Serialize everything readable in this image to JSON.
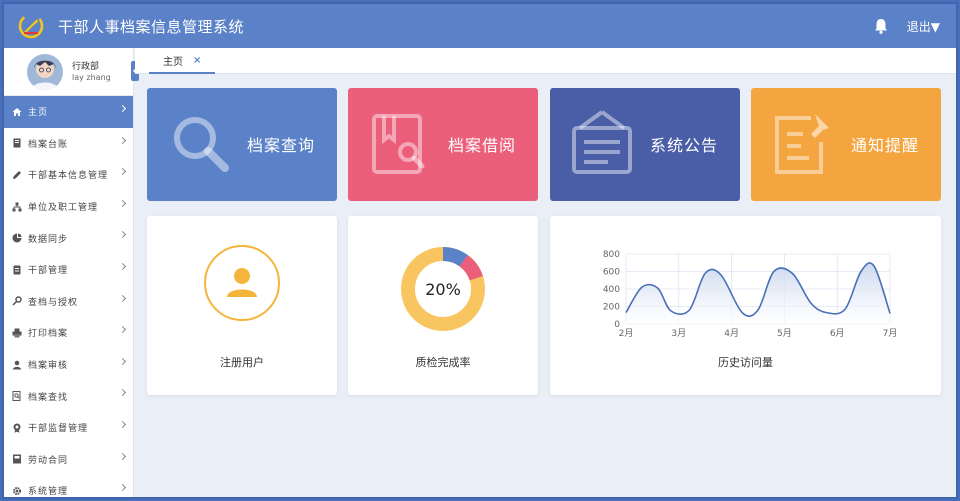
{
  "header": {
    "title": "干部人事档案信息管理系统",
    "logout_label": "退出▼"
  },
  "user": {
    "department": "行政部",
    "name": "lay zhang"
  },
  "sidebar": {
    "items": [
      {
        "label": "主页",
        "icon": "home-icon",
        "active": true
      },
      {
        "label": "档案台账",
        "icon": "book-icon"
      },
      {
        "label": "干部基本信息管理",
        "icon": "edit-icon"
      },
      {
        "label": "单位及职工管理",
        "icon": "org-icon"
      },
      {
        "label": "数据同步",
        "icon": "pie-icon"
      },
      {
        "label": "干部管理",
        "icon": "file-icon"
      },
      {
        "label": "查档与授权",
        "icon": "key-icon"
      },
      {
        "label": "打印档案",
        "icon": "print-icon"
      },
      {
        "label": "档案审核",
        "icon": "user-icon"
      },
      {
        "label": "档案查找",
        "icon": "search-doc-icon"
      },
      {
        "label": "干部监督管理",
        "icon": "badge-icon"
      },
      {
        "label": "劳动合同",
        "icon": "contract-icon"
      },
      {
        "label": "系统管理",
        "icon": "gear-icon"
      }
    ]
  },
  "tabs": [
    {
      "label": "主页",
      "close": "×"
    }
  ],
  "tiles": [
    {
      "label": "档案查询",
      "color": "#5b82c8",
      "icon": "search-icon"
    },
    {
      "label": "档案借阅",
      "color": "#ec5f7a",
      "icon": "book-search-icon"
    },
    {
      "label": "系统公告",
      "color": "#4a5ea8",
      "icon": "notice-board-icon"
    },
    {
      "label": "通知提醒",
      "color": "#f5a540",
      "icon": "note-pin-icon"
    }
  ],
  "stats": {
    "users_label": "注册用户",
    "quality_label": "质检完成率",
    "quality_value": "20%",
    "quality_percent": 20,
    "visits_label": "历史访问量"
  },
  "chart_data": {
    "type": "area",
    "title": "历史访问量",
    "x_ticks": [
      "2月",
      "3月",
      "4月",
      "5月",
      "6月",
      "7月"
    ],
    "y_ticks": [
      "800",
      "600",
      "400",
      "200",
      "0"
    ],
    "ylim": [
      0,
      800
    ],
    "series": [
      {
        "x": [
          1.0,
          1.3,
          1.6,
          1.85,
          2.2,
          2.5,
          2.8,
          3.2,
          3.5,
          3.8,
          4.15,
          4.5,
          4.8,
          5.15,
          5.45,
          5.7,
          6.0
        ],
        "y": [
          130,
          420,
          410,
          150,
          160,
          580,
          560,
          130,
          160,
          600,
          580,
          240,
          130,
          170,
          600,
          660,
          120
        ]
      }
    ],
    "grid": true,
    "colors": {
      "line": "#4a6fb8",
      "fill": "#c8d6ee"
    }
  }
}
